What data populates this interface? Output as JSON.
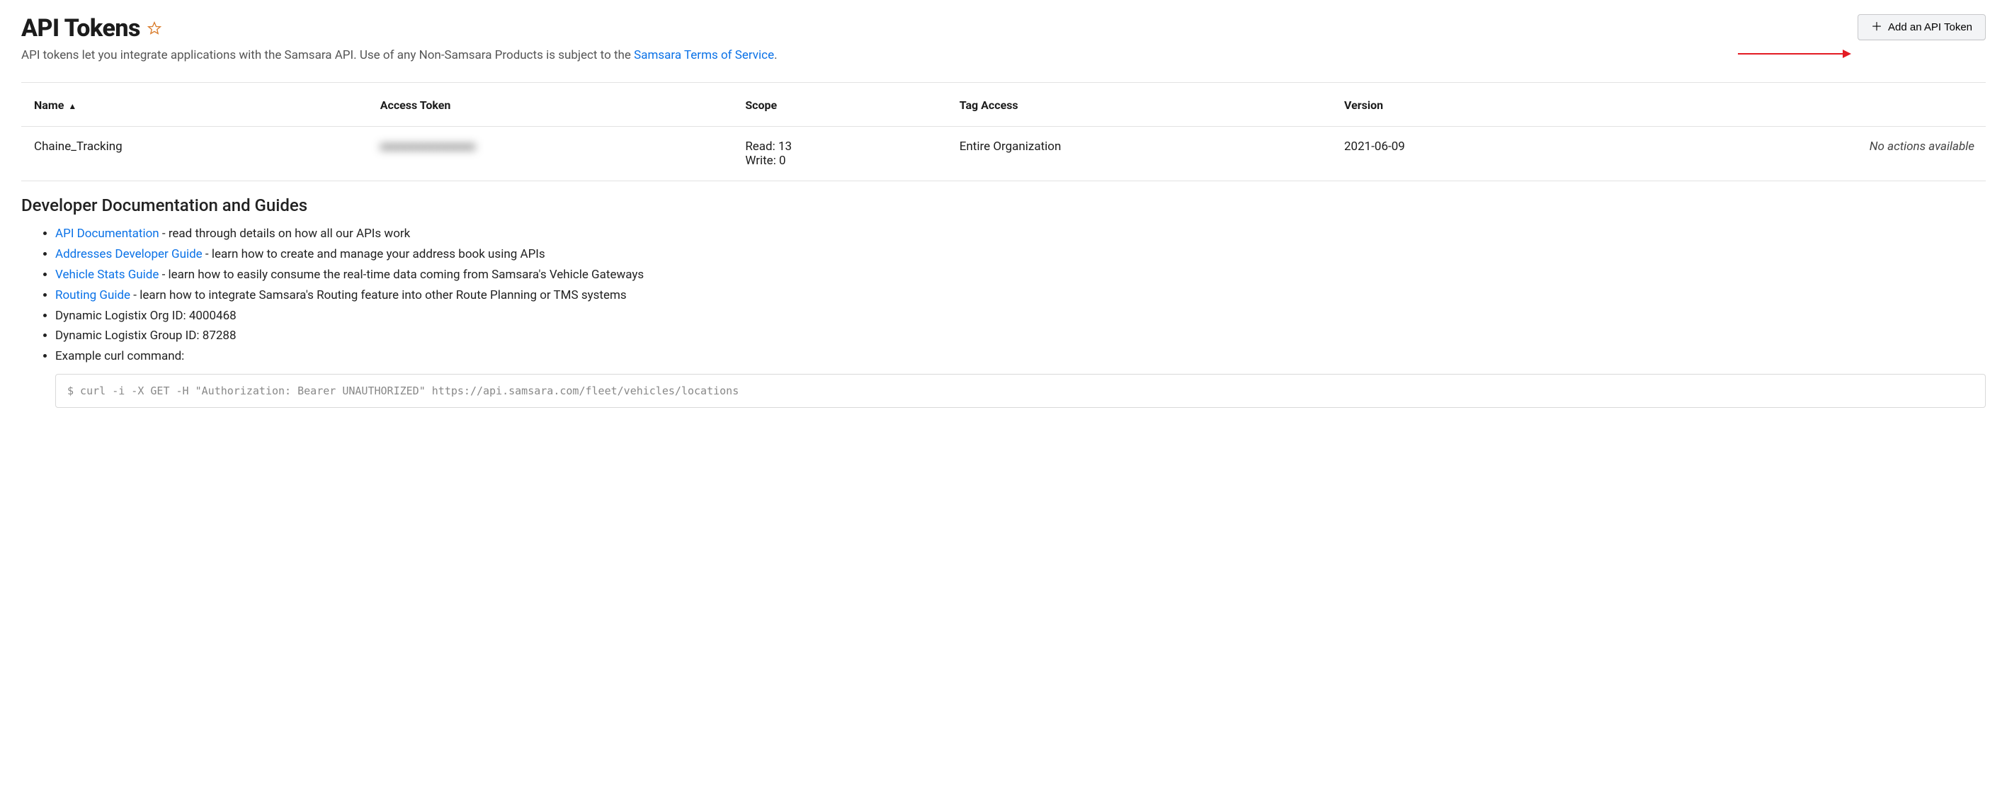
{
  "header": {
    "title": "API Tokens",
    "subtitle_prefix": "API tokens let you integrate applications with the Samsara API. Use of any Non-Samsara Products is subject to the ",
    "subtitle_link": "Samsara Terms of Service",
    "subtitle_suffix": ".",
    "add_button_label": "Add an API Token"
  },
  "table": {
    "columns": {
      "name": "Name",
      "access_token": "Access Token",
      "scope": "Scope",
      "tag_access": "Tag Access",
      "version": "Version"
    },
    "sort_indicator": "▲",
    "rows": [
      {
        "name": "Chaine_Tracking",
        "access_token_masked": "oooooooooooooo",
        "scope_read": "Read: 13",
        "scope_write": "Write: 0",
        "tag_access": "Entire Organization",
        "version": "2021-06-09",
        "actions": "No actions available"
      }
    ]
  },
  "docs": {
    "title": "Developer Documentation and Guides",
    "items": [
      {
        "link": "API Documentation",
        "text": " - read through details on how all our APIs work"
      },
      {
        "link": "Addresses Developer Guide",
        "text": " - learn how to create and manage your address book using APIs"
      },
      {
        "link": "Vehicle Stats Guide",
        "text": " - learn how to easily consume the real-time data coming from Samsara's Vehicle Gateways"
      },
      {
        "link": "Routing Guide",
        "text": " - learn how to integrate Samsara's Routing feature into other Route Planning or TMS systems"
      },
      {
        "link": "",
        "text": "Dynamic Logistix Org ID: 4000468"
      },
      {
        "link": "",
        "text": "Dynamic Logistix Group ID: 87288"
      },
      {
        "link": "",
        "text": "Example curl command:"
      }
    ],
    "curl_command": "$ curl -i -X GET -H \"Authorization: Bearer UNAUTHORIZED\" https://api.samsara.com/fleet/vehicles/locations"
  }
}
